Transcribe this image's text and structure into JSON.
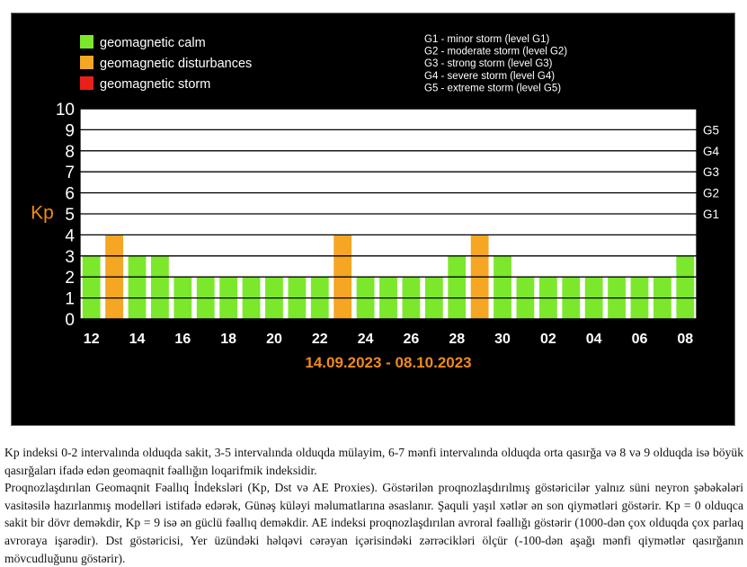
{
  "chart_data": {
    "type": "bar",
    "ylabel": "Kp",
    "ylim": [
      0,
      10
    ],
    "yticks": [
      "0",
      "1",
      "2",
      "3",
      "4",
      "5",
      "6",
      "7",
      "8",
      "9",
      "10"
    ],
    "right_axis_labels": [
      {
        "label": "G1",
        "level": 5
      },
      {
        "label": "G2",
        "level": 6
      },
      {
        "label": "G3",
        "level": 7
      },
      {
        "label": "G4",
        "level": 8
      },
      {
        "label": "G5",
        "level": 9
      }
    ],
    "x_tick_labels": [
      "12",
      "14",
      "16",
      "18",
      "20",
      "22",
      "24",
      "26",
      "28",
      "30",
      "02",
      "04",
      "06",
      "08"
    ],
    "date_range": "14.09.2023 - 08.10.2023",
    "values": [
      3,
      4,
      3,
      3,
      2,
      2,
      2,
      2,
      2,
      2,
      2,
      4,
      2,
      2,
      2,
      2,
      3,
      4,
      3,
      2,
      2,
      2,
      2,
      2,
      2,
      2,
      3
    ],
    "legend": [
      {
        "label": "geomagnetic calm",
        "color": "#7ce82c"
      },
      {
        "label": "geomagnetic disturbances",
        "color": "#f5a623"
      },
      {
        "label": "geomagnetic storm",
        "color": "#e8201a"
      }
    ],
    "storm_levels": [
      "G1 - minor storm (level G1)",
      "G2 - moderate storm (level G2)",
      "G3 - strong storm (level G3)",
      "G4 - severe storm (level G4)",
      "G5 - extreme storm (level G5)"
    ],
    "colors": {
      "calm": "#7ce82c",
      "disturbance": "#f5a623",
      "storm": "#e8201a",
      "grid": "#000000",
      "plot_bg": "#ffffff",
      "accent": "#f08a1c"
    }
  },
  "caption": [
    "Kp indeksi 0-2 intervalında olduqda sakit, 3-5 intervalında olduqda mülayim, 6-7 mənfi intervalında olduqda orta qasırğa və 8 və 9 olduqda isə böyük qasırğaları ifadə edən geomaqnit fəallığın loqarifmik indeksidir.",
    "Proqnozlaşdırılan Geomaqnit Fəallıq İndeksləri (Kp, Dst və AE Proxies). Göstərilən proqnozlaşdırılmış göstəricilər yalnız süni neyron şəbəkələri vasitəsilə hazırlanmış modelləri istifadə edərək, Günəş küləyi məlumatlarına əsaslanır. Şaquli yaşıl xətlər ən son qiymətləri göstərir. Kp = 0 olduqca sakit bir dövr deməkdir, Kp = 9 isə ən güclü fəallıq deməkdir. AE indeksi proqnozlaşdırılan avroral fəallığı göstərir (1000-dən çox olduqda çox parlaq avroraya işarədir). Dst göstəricisi, Yer üzündəki həlqəvi cərəyan içərisindəki zərrəcikləri ölçür (-100-dən aşağı mənfi qiymətlər qasırğanın mövcudluğunu göstərir)."
  ]
}
